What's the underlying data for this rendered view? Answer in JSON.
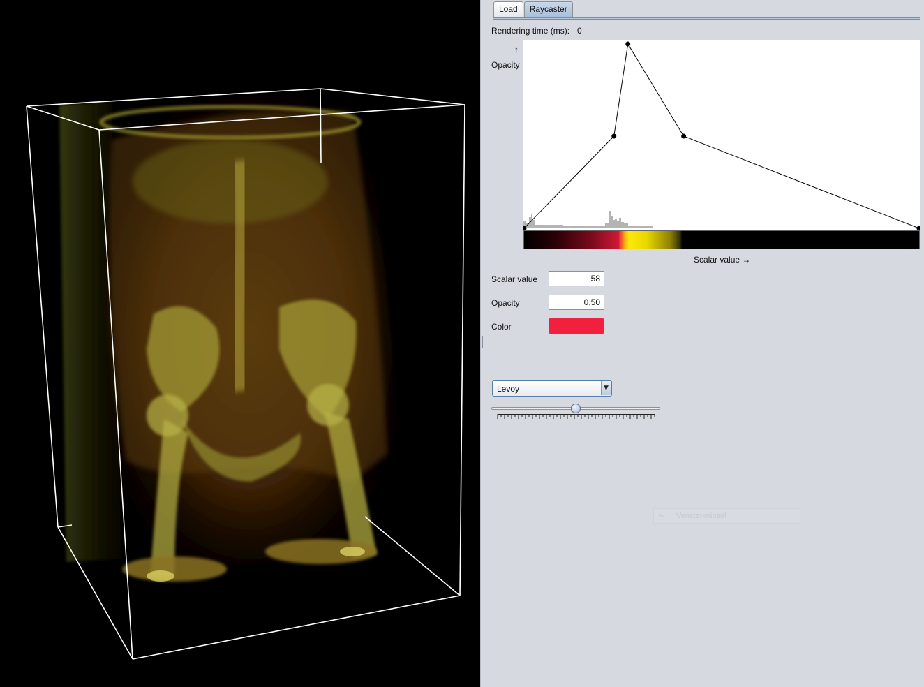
{
  "tabs": [
    {
      "label": "Load",
      "active": false
    },
    {
      "label": "Raycaster",
      "active": true
    }
  ],
  "rendering_time": {
    "label": "Rendering time (ms):",
    "value": "0"
  },
  "tf_editor": {
    "y_arrow": "↑",
    "y_label": "Opacity",
    "x_label": "Scalar value →",
    "control_points": [
      {
        "scalar": 0,
        "opacity": 0.0
      },
      {
        "scalar": 58,
        "opacity": 0.5
      },
      {
        "scalar": 67,
        "opacity": 1.0
      },
      {
        "scalar": 103,
        "opacity": 0.5
      },
      {
        "scalar": 255,
        "opacity": 0.0
      }
    ],
    "colormap": [
      "#000000",
      "#7a0a1c",
      "#f0203e",
      "#ffe80a",
      "#000000"
    ]
  },
  "fields": {
    "scalar_label": "Scalar value",
    "scalar_value": "58",
    "opacity_label": "Opacity",
    "opacity_value": "0,50",
    "color_label": "Color",
    "color_value": "#f0203e"
  },
  "mode_select": {
    "selected": "Levoy"
  },
  "slider": {
    "value": 0.5
  },
  "ghost_item": {
    "label": "Vensterknipsel",
    "icon": "scissors-icon"
  },
  "viewport": {
    "bounding_box_color": "#ffffff",
    "volume_tint": "#c8b010"
  }
}
